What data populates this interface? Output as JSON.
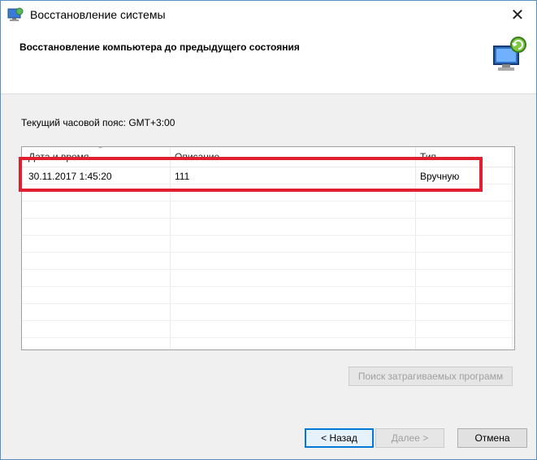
{
  "window": {
    "title": "Восстановление системы"
  },
  "header": {
    "title": "Восстановление компьютера до предыдущего состояния"
  },
  "timezone_text": "Текущий часовой пояс: GMT+3:00",
  "table": {
    "columns": [
      "Дата и время",
      "Описание",
      "Тип"
    ],
    "rows": [
      {
        "date": "30.11.2017 1:45:20",
        "description": "111",
        "type": "Вручную"
      }
    ]
  },
  "buttons": {
    "scan": "Поиск затрагиваемых программ",
    "back": "< Назад",
    "next": "Далее >",
    "cancel": "Отмена"
  },
  "colors": {
    "highlight": "#e0202e",
    "focus": "#0078d7"
  }
}
